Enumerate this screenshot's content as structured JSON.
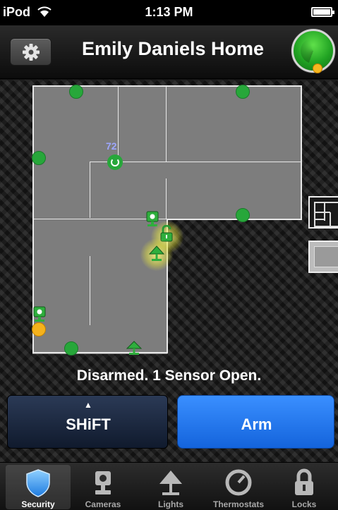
{
  "status_bar": {
    "carrier": "iPod",
    "time": "1:13 PM"
  },
  "nav": {
    "title": "Emily Daniels Home"
  },
  "floorplan": {
    "temperature": "72"
  },
  "status_message": "Disarmed. 1 Sensor Open.",
  "buttons": {
    "shift_caret": "▲",
    "shift": "SHiFT",
    "arm": "Arm"
  },
  "tabs": [
    {
      "label": "Security",
      "icon": "shield-icon",
      "active": true
    },
    {
      "label": "Cameras",
      "icon": "camera-icon",
      "active": false
    },
    {
      "label": "Lights",
      "icon": "lamp-icon",
      "active": false
    },
    {
      "label": "Thermostats",
      "icon": "thermostat-icon",
      "active": false
    },
    {
      "label": "Locks",
      "icon": "lock-icon",
      "active": false
    }
  ],
  "colors": {
    "sensor_closed": "#27a73a",
    "sensor_open": "#f5b21c",
    "arm": "#1f74ee",
    "shift": "#1c2a44"
  }
}
